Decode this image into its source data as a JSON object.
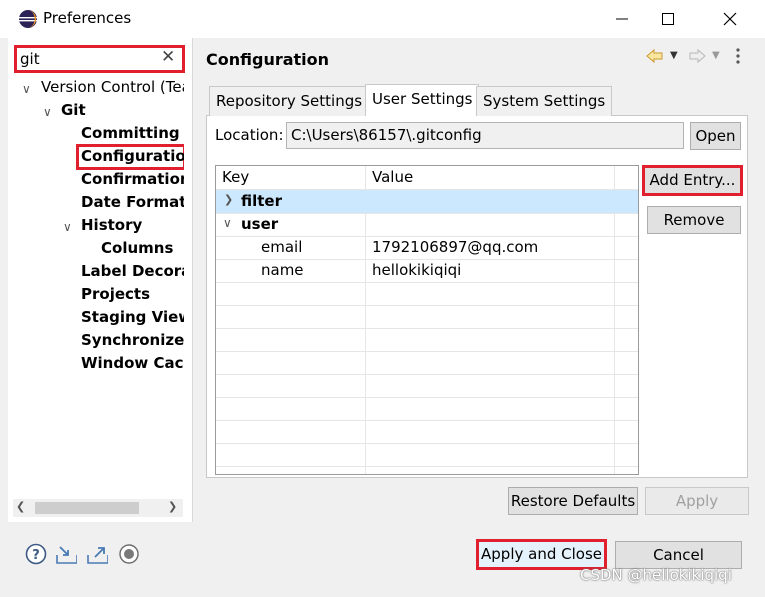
{
  "window": {
    "title": "Preferences",
    "minimize": "—",
    "maximize": "☐",
    "close": "✕"
  },
  "search": {
    "value": "git",
    "clear": "✕"
  },
  "tree": {
    "items": [
      {
        "label": "Version Control (Team)",
        "depth": 0,
        "expanded": true
      },
      {
        "label": "Git",
        "depth": 1,
        "expanded": true
      },
      {
        "label": "Committing",
        "depth": 2
      },
      {
        "label": "Configuration",
        "depth": 2,
        "selected": true
      },
      {
        "label": "Confirmations and Warnings",
        "depth": 2
      },
      {
        "label": "Date Format",
        "depth": 2
      },
      {
        "label": "History",
        "depth": 2,
        "expanded": true
      },
      {
        "label": "Columns",
        "depth": 3
      },
      {
        "label": "Label Decorations",
        "depth": 2
      },
      {
        "label": "Projects",
        "depth": 2
      },
      {
        "label": "Staging View",
        "depth": 2
      },
      {
        "label": "Synchronize",
        "depth": 2
      },
      {
        "label": "Window Cache",
        "depth": 2
      }
    ]
  },
  "page": {
    "title": "Configuration"
  },
  "nav": {
    "back_icon": "back-arrow-icon",
    "forward_icon": "forward-arrow-icon",
    "menu_icon": "view-menu-icon"
  },
  "tabs": [
    {
      "label": "Repository Settings",
      "active": false
    },
    {
      "label": "User Settings",
      "active": true
    },
    {
      "label": "System Settings",
      "active": false
    }
  ],
  "location": {
    "label": "Location:",
    "value": "C:\\Users\\86157\\.gitconfig",
    "open_label": "Open"
  },
  "table": {
    "columns": [
      "Key",
      "Value"
    ],
    "rows": [
      {
        "key": "filter",
        "value": "",
        "section": true,
        "expanded": false
      },
      {
        "key": "user",
        "value": "",
        "section": true,
        "expanded": true
      },
      {
        "key": "email",
        "value": "1792106897@qq.com",
        "section": false
      },
      {
        "key": "name",
        "value": "hellokikiqiqi",
        "section": false
      }
    ]
  },
  "side_buttons": {
    "add_entry": "Add Entry...",
    "remove": "Remove"
  },
  "page_buttons": {
    "restore_defaults": "Restore Defaults",
    "apply": "Apply"
  },
  "dialog_buttons": {
    "apply_and_close": "Apply and Close",
    "cancel": "Cancel"
  },
  "bottom_icons": [
    "help-icon",
    "import-icon",
    "export-icon",
    "oomph-icon"
  ],
  "watermark": "CSDN @hellokikiqiqi",
  "colors": {
    "highlight": "#e0202f",
    "selected_row": "#cce8ff",
    "eclipse_blue": "#2c2255"
  }
}
